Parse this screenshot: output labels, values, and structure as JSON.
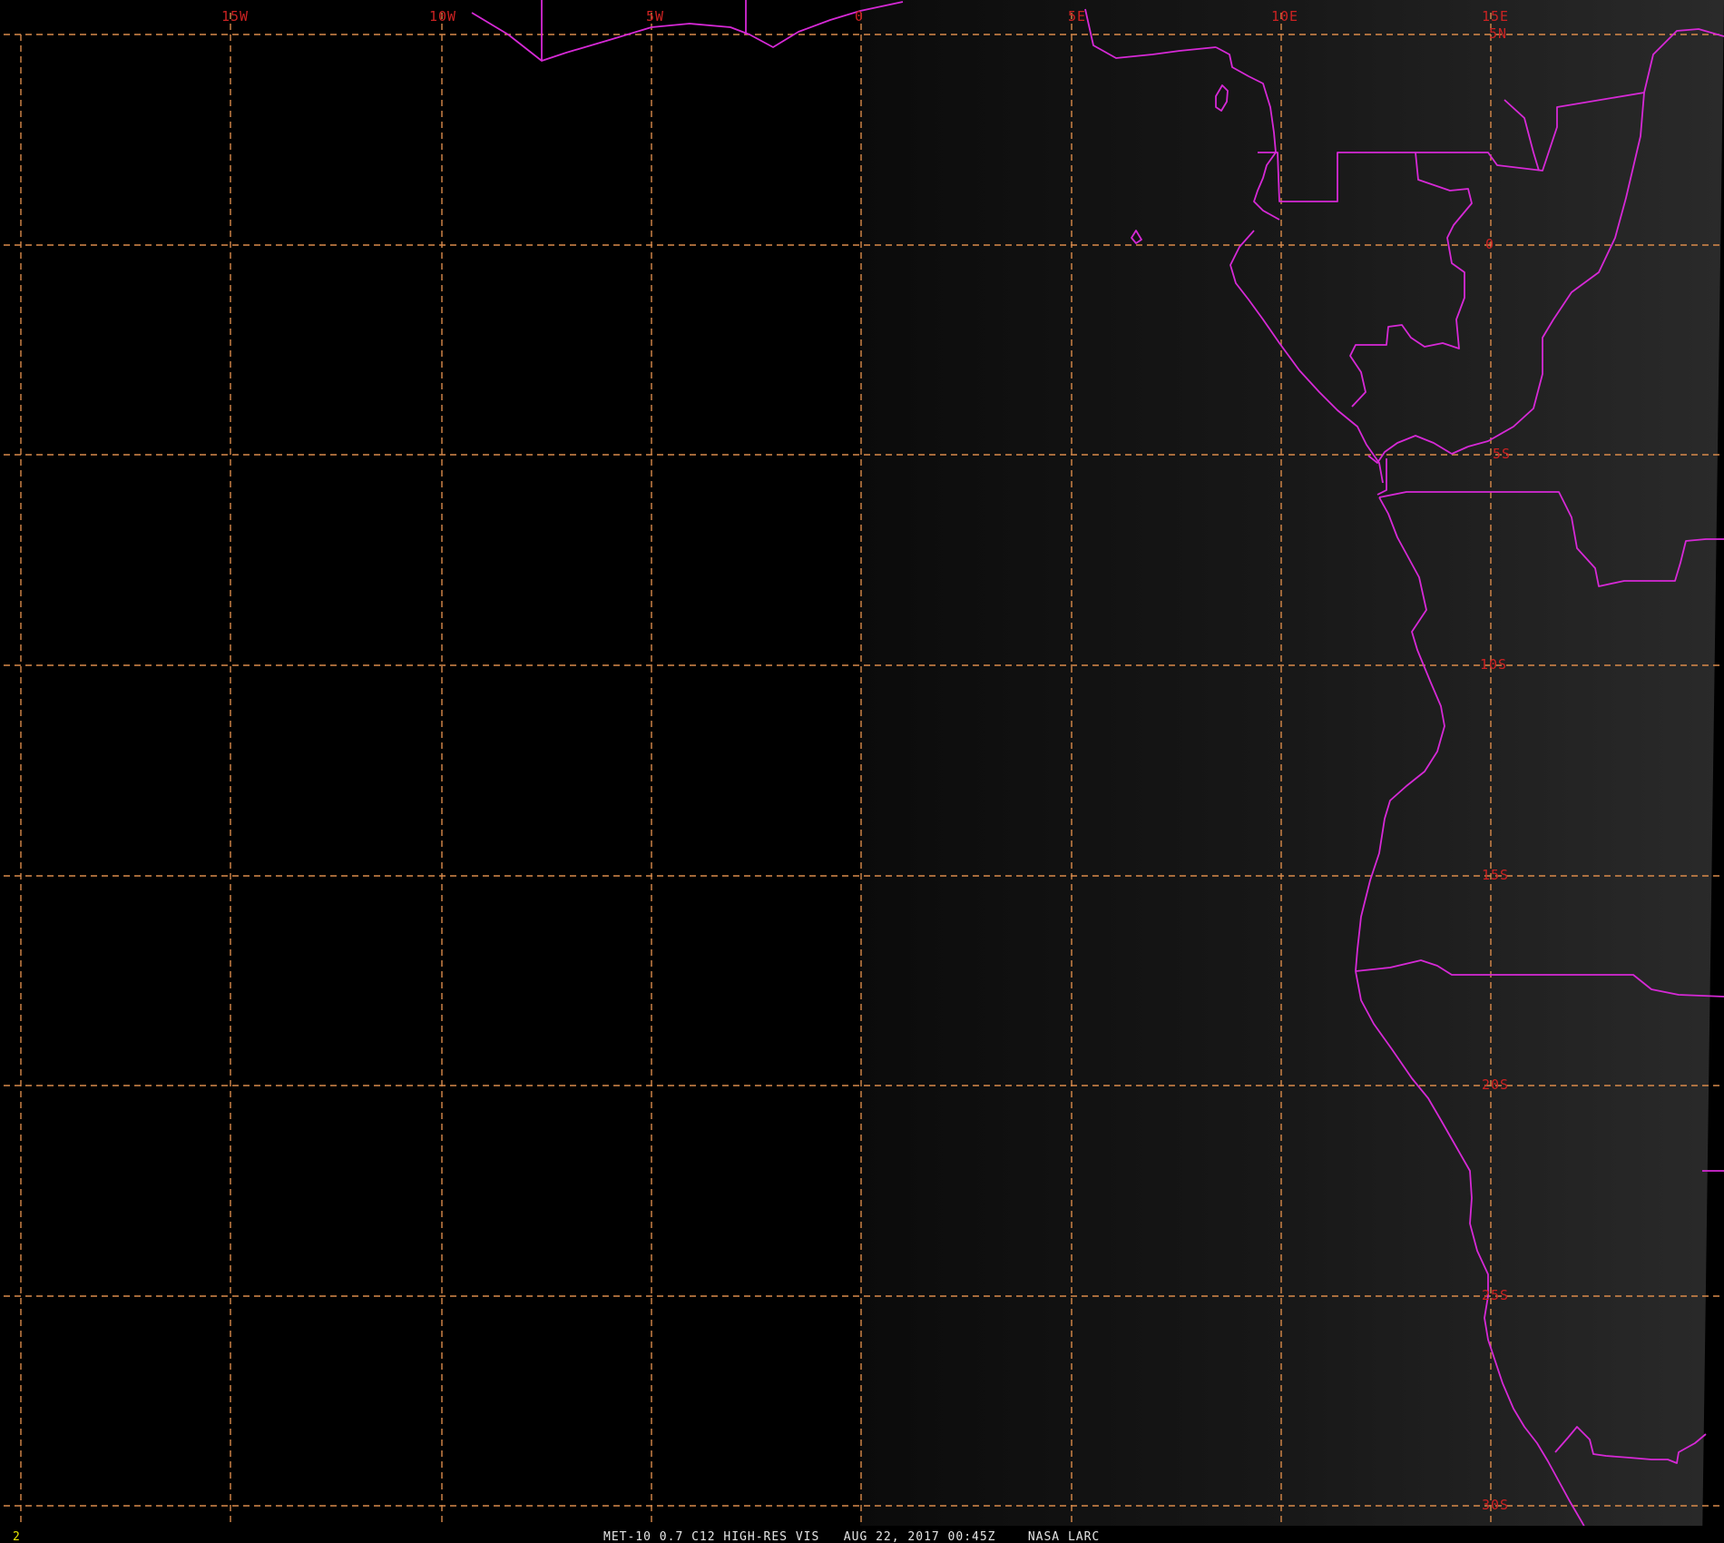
{
  "map": {
    "frame_number": "2",
    "caption": "MET-10 0.7 C12 HIGH-RES VIS   AUG 22, 2017 00:45Z    NASA LARC",
    "colors": {
      "background_dark": "#000000",
      "background_lit": "#262626",
      "grid": "#d98a4a",
      "grid_labels": "#cc2222",
      "coastlines": "#d629d6",
      "caption_text": "#e6e6e6",
      "frame_number": "#e6e600"
    },
    "longitude_labels": [
      "15W",
      "10W",
      "5W",
      "0",
      "5E",
      "10E",
      "15E"
    ],
    "latitude_labels": [
      "5N",
      "0",
      "5S",
      "10S",
      "15S",
      "20S",
      "25S",
      "30S"
    ]
  }
}
